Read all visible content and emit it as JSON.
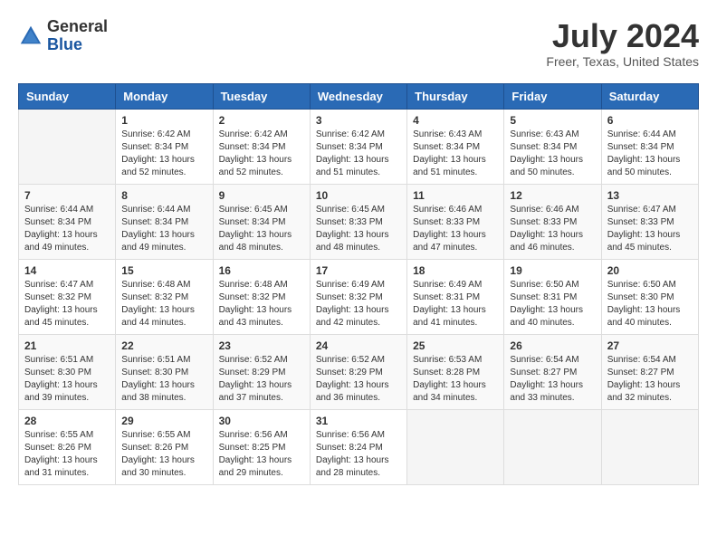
{
  "header": {
    "logo_general": "General",
    "logo_blue": "Blue",
    "month_year": "July 2024",
    "location": "Freer, Texas, United States"
  },
  "weekdays": [
    "Sunday",
    "Monday",
    "Tuesday",
    "Wednesday",
    "Thursday",
    "Friday",
    "Saturday"
  ],
  "weeks": [
    [
      {
        "day": "",
        "info": ""
      },
      {
        "day": "1",
        "info": "Sunrise: 6:42 AM\nSunset: 8:34 PM\nDaylight: 13 hours\nand 52 minutes."
      },
      {
        "day": "2",
        "info": "Sunrise: 6:42 AM\nSunset: 8:34 PM\nDaylight: 13 hours\nand 52 minutes."
      },
      {
        "day": "3",
        "info": "Sunrise: 6:42 AM\nSunset: 8:34 PM\nDaylight: 13 hours\nand 51 minutes."
      },
      {
        "day": "4",
        "info": "Sunrise: 6:43 AM\nSunset: 8:34 PM\nDaylight: 13 hours\nand 51 minutes."
      },
      {
        "day": "5",
        "info": "Sunrise: 6:43 AM\nSunset: 8:34 PM\nDaylight: 13 hours\nand 50 minutes."
      },
      {
        "day": "6",
        "info": "Sunrise: 6:44 AM\nSunset: 8:34 PM\nDaylight: 13 hours\nand 50 minutes."
      }
    ],
    [
      {
        "day": "7",
        "info": "Sunrise: 6:44 AM\nSunset: 8:34 PM\nDaylight: 13 hours\nand 49 minutes."
      },
      {
        "day": "8",
        "info": "Sunrise: 6:44 AM\nSunset: 8:34 PM\nDaylight: 13 hours\nand 49 minutes."
      },
      {
        "day": "9",
        "info": "Sunrise: 6:45 AM\nSunset: 8:34 PM\nDaylight: 13 hours\nand 48 minutes."
      },
      {
        "day": "10",
        "info": "Sunrise: 6:45 AM\nSunset: 8:33 PM\nDaylight: 13 hours\nand 48 minutes."
      },
      {
        "day": "11",
        "info": "Sunrise: 6:46 AM\nSunset: 8:33 PM\nDaylight: 13 hours\nand 47 minutes."
      },
      {
        "day": "12",
        "info": "Sunrise: 6:46 AM\nSunset: 8:33 PM\nDaylight: 13 hours\nand 46 minutes."
      },
      {
        "day": "13",
        "info": "Sunrise: 6:47 AM\nSunset: 8:33 PM\nDaylight: 13 hours\nand 45 minutes."
      }
    ],
    [
      {
        "day": "14",
        "info": "Sunrise: 6:47 AM\nSunset: 8:32 PM\nDaylight: 13 hours\nand 45 minutes."
      },
      {
        "day": "15",
        "info": "Sunrise: 6:48 AM\nSunset: 8:32 PM\nDaylight: 13 hours\nand 44 minutes."
      },
      {
        "day": "16",
        "info": "Sunrise: 6:48 AM\nSunset: 8:32 PM\nDaylight: 13 hours\nand 43 minutes."
      },
      {
        "day": "17",
        "info": "Sunrise: 6:49 AM\nSunset: 8:32 PM\nDaylight: 13 hours\nand 42 minutes."
      },
      {
        "day": "18",
        "info": "Sunrise: 6:49 AM\nSunset: 8:31 PM\nDaylight: 13 hours\nand 41 minutes."
      },
      {
        "day": "19",
        "info": "Sunrise: 6:50 AM\nSunset: 8:31 PM\nDaylight: 13 hours\nand 40 minutes."
      },
      {
        "day": "20",
        "info": "Sunrise: 6:50 AM\nSunset: 8:30 PM\nDaylight: 13 hours\nand 40 minutes."
      }
    ],
    [
      {
        "day": "21",
        "info": "Sunrise: 6:51 AM\nSunset: 8:30 PM\nDaylight: 13 hours\nand 39 minutes."
      },
      {
        "day": "22",
        "info": "Sunrise: 6:51 AM\nSunset: 8:30 PM\nDaylight: 13 hours\nand 38 minutes."
      },
      {
        "day": "23",
        "info": "Sunrise: 6:52 AM\nSunset: 8:29 PM\nDaylight: 13 hours\nand 37 minutes."
      },
      {
        "day": "24",
        "info": "Sunrise: 6:52 AM\nSunset: 8:29 PM\nDaylight: 13 hours\nand 36 minutes."
      },
      {
        "day": "25",
        "info": "Sunrise: 6:53 AM\nSunset: 8:28 PM\nDaylight: 13 hours\nand 34 minutes."
      },
      {
        "day": "26",
        "info": "Sunrise: 6:54 AM\nSunset: 8:27 PM\nDaylight: 13 hours\nand 33 minutes."
      },
      {
        "day": "27",
        "info": "Sunrise: 6:54 AM\nSunset: 8:27 PM\nDaylight: 13 hours\nand 32 minutes."
      }
    ],
    [
      {
        "day": "28",
        "info": "Sunrise: 6:55 AM\nSunset: 8:26 PM\nDaylight: 13 hours\nand 31 minutes."
      },
      {
        "day": "29",
        "info": "Sunrise: 6:55 AM\nSunset: 8:26 PM\nDaylight: 13 hours\nand 30 minutes."
      },
      {
        "day": "30",
        "info": "Sunrise: 6:56 AM\nSunset: 8:25 PM\nDaylight: 13 hours\nand 29 minutes."
      },
      {
        "day": "31",
        "info": "Sunrise: 6:56 AM\nSunset: 8:24 PM\nDaylight: 13 hours\nand 28 minutes."
      },
      {
        "day": "",
        "info": ""
      },
      {
        "day": "",
        "info": ""
      },
      {
        "day": "",
        "info": ""
      }
    ]
  ]
}
